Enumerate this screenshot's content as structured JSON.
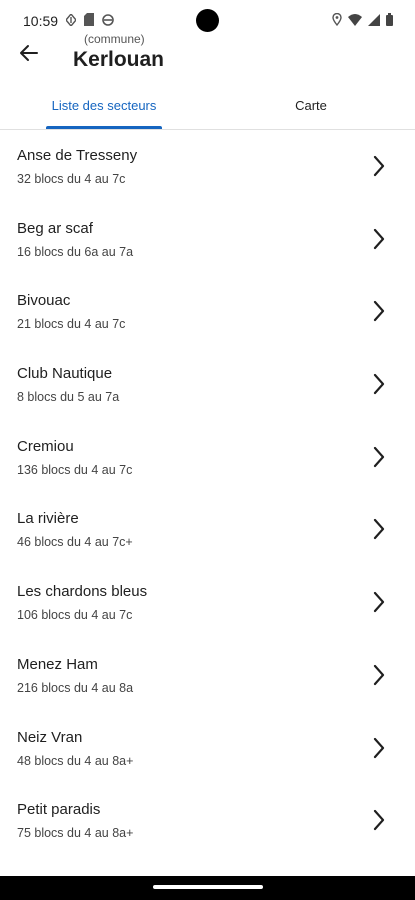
{
  "status_bar": {
    "time": "10:59",
    "left_icons": [
      "navigation-icon",
      "sim-card-icon",
      "shield-icon"
    ],
    "right_icons": [
      "location-icon",
      "wifi-icon",
      "signal-icon",
      "battery-icon"
    ]
  },
  "header": {
    "subtitle": "(commune)",
    "title": "Kerlouan"
  },
  "tabs": [
    {
      "label": "Liste des secteurs",
      "active": true
    },
    {
      "label": "Carte",
      "active": false
    }
  ],
  "colors": {
    "accent": "#1565c0"
  },
  "sectors": [
    {
      "name": "Anse de Tresseny",
      "detail": "32 blocs du 4 au 7c"
    },
    {
      "name": "Beg ar scaf",
      "detail": "16 blocs du 6a au 7a"
    },
    {
      "name": "Bivouac",
      "detail": "21 blocs du 4 au 7c"
    },
    {
      "name": "Club Nautique",
      "detail": "8 blocs du 5 au 7a"
    },
    {
      "name": "Cremiou",
      "detail": "136 blocs du 4 au 7c"
    },
    {
      "name": "La rivière",
      "detail": "46 blocs du 4 au 7c+"
    },
    {
      "name": "Les chardons bleus",
      "detail": "106 blocs du 4 au 7c"
    },
    {
      "name": "Menez Ham",
      "detail": "216 blocs du 4 au 8a"
    },
    {
      "name": "Neiz Vran",
      "detail": "48 blocs du 4 au 8a+"
    },
    {
      "name": "Petit paradis",
      "detail": "75 blocs du 4 au 8a+"
    }
  ]
}
